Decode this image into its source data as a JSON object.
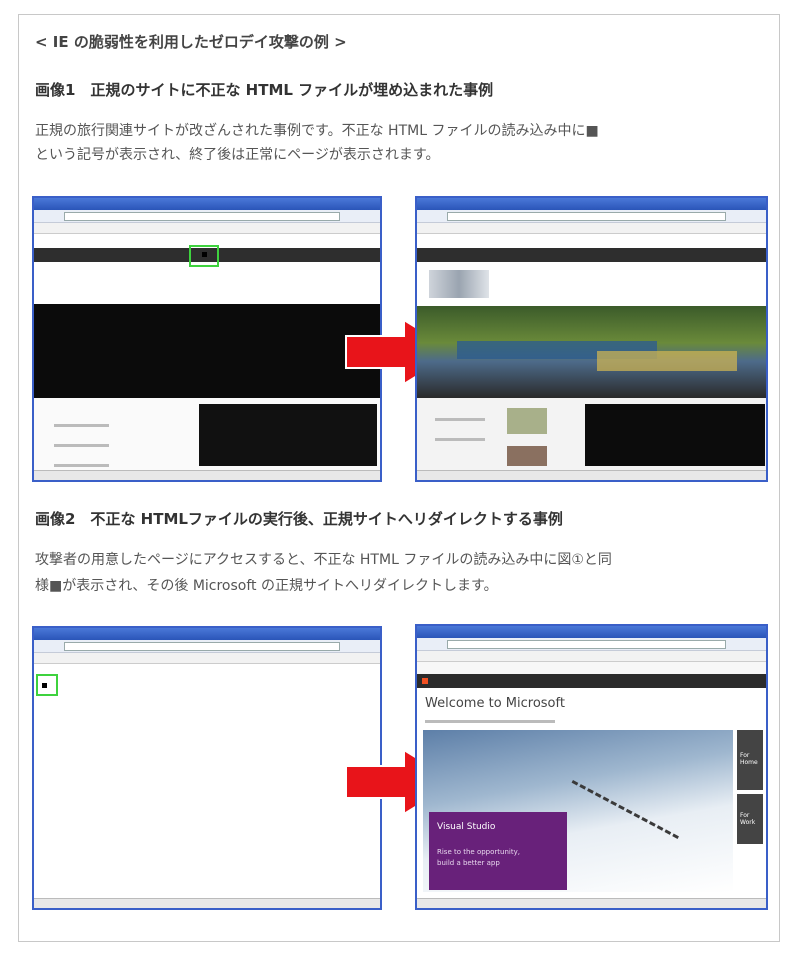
{
  "heading": "< IE の脆弱性を利用したゼロデイ攻撃の例 >",
  "section1": {
    "title": "画像1　正規のサイトに不正な HTML ファイルが埋め込まれた事例",
    "line1": "正規の旅行関連サイトが改ざんされた事例です。不正な HTML ファイルの読み込み中に■",
    "line2": "という記号が表示され、終了後は正常にページが表示されます。"
  },
  "section2": {
    "title": "画像2　不正な HTMLファイルの実行後、正規サイトへリダイレクトする事例",
    "line1": "攻撃者の用意したページにアクセスすると、不正な HTML ファイルの読み込み中に図①と同",
    "line2": "様■が表示され、その後 Microsoft の正規サイトへリダイレクトします。"
  },
  "ms_site": {
    "welcome": "Welcome to Microsoft",
    "vs_title": "Visual Studio",
    "vs_text1": "Rise to the opportunity,",
    "vs_text2": "build a better app",
    "side1": "For Home",
    "side2": "For Work"
  },
  "colors": {
    "arrow": "#e8141a",
    "highlight": "#3ed23e",
    "window_border": "#3a5fc8",
    "vs_purple": "#68217a"
  }
}
